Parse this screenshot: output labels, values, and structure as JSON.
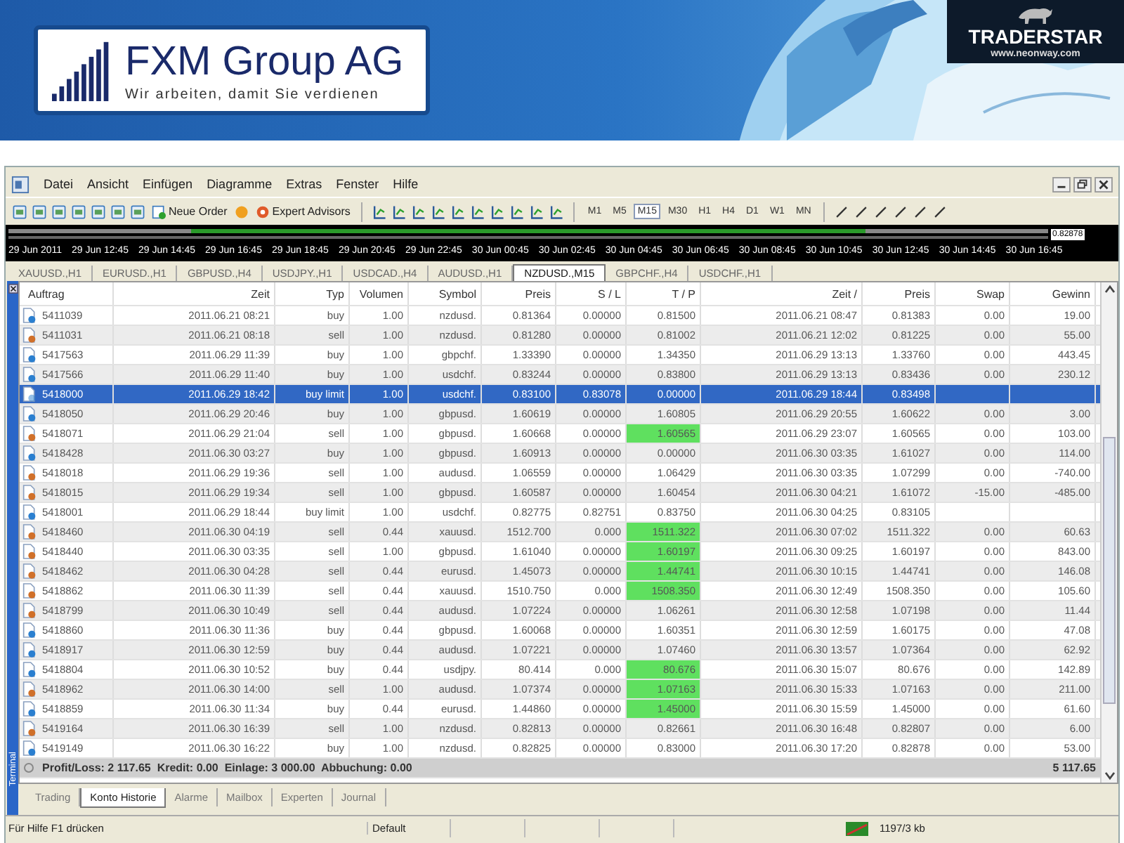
{
  "banner": {
    "company": "FXM Group AG",
    "slogan": "Wir arbeiten, damit Sie verdienen",
    "partner_name": "TRADERSTAR",
    "partner_url": "www.neonway.com"
  },
  "menu": [
    "Datei",
    "Ansicht",
    "Einfügen",
    "Diagramme",
    "Extras",
    "Fenster",
    "Hilfe"
  ],
  "toolbar": {
    "order_button": "Neue Order",
    "experts_button": "Expert Advisors",
    "timeframes": [
      {
        "label": "M1",
        "selected": false
      },
      {
        "label": "M5",
        "selected": false
      },
      {
        "label": "M15",
        "selected": true
      },
      {
        "label": "M30",
        "selected": false
      },
      {
        "label": "H1",
        "selected": false
      },
      {
        "label": "H4",
        "selected": false
      },
      {
        "label": "D1",
        "selected": false
      },
      {
        "label": "W1",
        "selected": false
      },
      {
        "label": "MN",
        "selected": false
      }
    ]
  },
  "chart": {
    "price_label": "0.82878",
    "time_labels": [
      "29 Jun 2011",
      "29 Jun 12:45",
      "29 Jun 14:45",
      "29 Jun 16:45",
      "29 Jun 18:45",
      "29 Jun 20:45",
      "29 Jun 22:45",
      "30 Jun 00:45",
      "30 Jun 02:45",
      "30 Jun 04:45",
      "30 Jun 06:45",
      "30 Jun 08:45",
      "30 Jun 10:45",
      "30 Jun 12:45",
      "30 Jun 14:45",
      "30 Jun 16:45"
    ]
  },
  "chart_tabs": [
    {
      "label": "XAUUSD.,H1",
      "selected": false
    },
    {
      "label": "EURUSD.,H1",
      "selected": false
    },
    {
      "label": "GBPUSD.,H4",
      "selected": false
    },
    {
      "label": "USDJPY.,H1",
      "selected": false
    },
    {
      "label": "USDCAD.,H4",
      "selected": false
    },
    {
      "label": "AUDUSD.,H1",
      "selected": false
    },
    {
      "label": "NZDUSD.,M15",
      "selected": true
    },
    {
      "label": "GBPCHF.,H4",
      "selected": false
    },
    {
      "label": "USDCHF.,H1",
      "selected": false
    }
  ],
  "terminal_label": "Terminal",
  "table": {
    "columns": [
      "Auftrag",
      "Zeit",
      "Typ",
      "Volumen",
      "Symbol",
      "Preis",
      "S / L",
      "T / P",
      "Zeit  /",
      "Preis",
      "Swap",
      "Gewinn"
    ],
    "rows": [
      {
        "kind": "buy",
        "selected": false,
        "tp_hit": false,
        "cells": [
          "5411039",
          "2011.06.21 08:21",
          "buy",
          "1.00",
          "nzdusd.",
          "0.81364",
          "0.00000",
          "0.81500",
          "2011.06.21 08:47",
          "0.81383",
          "0.00",
          "19.00"
        ]
      },
      {
        "kind": "sell",
        "selected": false,
        "tp_hit": false,
        "cells": [
          "5411031",
          "2011.06.21 08:18",
          "sell",
          "1.00",
          "nzdusd.",
          "0.81280",
          "0.00000",
          "0.81002",
          "2011.06.21 12:02",
          "0.81225",
          "0.00",
          "55.00"
        ]
      },
      {
        "kind": "buy",
        "selected": false,
        "tp_hit": false,
        "cells": [
          "5417563",
          "2011.06.29 11:39",
          "buy",
          "1.00",
          "gbpchf.",
          "1.33390",
          "0.00000",
          "1.34350",
          "2011.06.29 13:13",
          "1.33760",
          "0.00",
          "443.45"
        ]
      },
      {
        "kind": "buy",
        "selected": false,
        "tp_hit": false,
        "cells": [
          "5417566",
          "2011.06.29 11:40",
          "buy",
          "1.00",
          "usdchf.",
          "0.83244",
          "0.00000",
          "0.83800",
          "2011.06.29 13:13",
          "0.83436",
          "0.00",
          "230.12"
        ]
      },
      {
        "kind": "buy",
        "selected": true,
        "tp_hit": false,
        "cells": [
          "5418000",
          "2011.06.29 18:42",
          "buy limit",
          "1.00",
          "usdchf.",
          "0.83100",
          "0.83078",
          "0.00000",
          "2011.06.29 18:44",
          "0.83498",
          "",
          ""
        ]
      },
      {
        "kind": "buy",
        "selected": false,
        "tp_hit": false,
        "cells": [
          "5418050",
          "2011.06.29 20:46",
          "buy",
          "1.00",
          "gbpusd.",
          "1.60619",
          "0.00000",
          "1.60805",
          "2011.06.29 20:55",
          "1.60622",
          "0.00",
          "3.00"
        ]
      },
      {
        "kind": "sell",
        "selected": false,
        "tp_hit": true,
        "cells": [
          "5418071",
          "2011.06.29 21:04",
          "sell",
          "1.00",
          "gbpusd.",
          "1.60668",
          "0.00000",
          "1.60565",
          "2011.06.29 23:07",
          "1.60565",
          "0.00",
          "103.00"
        ]
      },
      {
        "kind": "buy",
        "selected": false,
        "tp_hit": false,
        "cells": [
          "5418428",
          "2011.06.30 03:27",
          "buy",
          "1.00",
          "gbpusd.",
          "1.60913",
          "0.00000",
          "0.00000",
          "2011.06.30 03:35",
          "1.61027",
          "0.00",
          "114.00"
        ]
      },
      {
        "kind": "sell",
        "selected": false,
        "tp_hit": false,
        "cells": [
          "5418018",
          "2011.06.29 19:36",
          "sell",
          "1.00",
          "audusd.",
          "1.06559",
          "0.00000",
          "1.06429",
          "2011.06.30 03:35",
          "1.07299",
          "0.00",
          "-740.00"
        ]
      },
      {
        "kind": "sell",
        "selected": false,
        "tp_hit": false,
        "cells": [
          "5418015",
          "2011.06.29 19:34",
          "sell",
          "1.00",
          "gbpusd.",
          "1.60587",
          "0.00000",
          "1.60454",
          "2011.06.30 04:21",
          "1.61072",
          "-15.00",
          "-485.00"
        ]
      },
      {
        "kind": "buy",
        "selected": false,
        "tp_hit": false,
        "cells": [
          "5418001",
          "2011.06.29 18:44",
          "buy limit",
          "1.00",
          "usdchf.",
          "0.82775",
          "0.82751",
          "0.83750",
          "2011.06.30 04:25",
          "0.83105",
          "",
          ""
        ]
      },
      {
        "kind": "sell",
        "selected": false,
        "tp_hit": true,
        "cells": [
          "5418460",
          "2011.06.30 04:19",
          "sell",
          "0.44",
          "xauusd.",
          "1512.700",
          "0.000",
          "1511.322",
          "2011.06.30 07:02",
          "1511.322",
          "0.00",
          "60.63"
        ]
      },
      {
        "kind": "sell",
        "selected": false,
        "tp_hit": true,
        "cells": [
          "5418440",
          "2011.06.30 03:35",
          "sell",
          "1.00",
          "gbpusd.",
          "1.61040",
          "0.00000",
          "1.60197",
          "2011.06.30 09:25",
          "1.60197",
          "0.00",
          "843.00"
        ]
      },
      {
        "kind": "sell",
        "selected": false,
        "tp_hit": true,
        "cells": [
          "5418462",
          "2011.06.30 04:28",
          "sell",
          "0.44",
          "eurusd.",
          "1.45073",
          "0.00000",
          "1.44741",
          "2011.06.30 10:15",
          "1.44741",
          "0.00",
          "146.08"
        ]
      },
      {
        "kind": "sell",
        "selected": false,
        "tp_hit": true,
        "cells": [
          "5418862",
          "2011.06.30 11:39",
          "sell",
          "0.44",
          "xauusd.",
          "1510.750",
          "0.000",
          "1508.350",
          "2011.06.30 12:49",
          "1508.350",
          "0.00",
          "105.60"
        ]
      },
      {
        "kind": "sell",
        "selected": false,
        "tp_hit": false,
        "cells": [
          "5418799",
          "2011.06.30 10:49",
          "sell",
          "0.44",
          "audusd.",
          "1.07224",
          "0.00000",
          "1.06261",
          "2011.06.30 12:58",
          "1.07198",
          "0.00",
          "11.44"
        ]
      },
      {
        "kind": "buy",
        "selected": false,
        "tp_hit": false,
        "cells": [
          "5418860",
          "2011.06.30 11:36",
          "buy",
          "0.44",
          "gbpusd.",
          "1.60068",
          "0.00000",
          "1.60351",
          "2011.06.30 12:59",
          "1.60175",
          "0.00",
          "47.08"
        ]
      },
      {
        "kind": "buy",
        "selected": false,
        "tp_hit": false,
        "cells": [
          "5418917",
          "2011.06.30 12:59",
          "buy",
          "0.44",
          "audusd.",
          "1.07221",
          "0.00000",
          "1.07460",
          "2011.06.30 13:57",
          "1.07364",
          "0.00",
          "62.92"
        ]
      },
      {
        "kind": "buy",
        "selected": false,
        "tp_hit": true,
        "cells": [
          "5418804",
          "2011.06.30 10:52",
          "buy",
          "0.44",
          "usdjpy.",
          "80.414",
          "0.000",
          "80.676",
          "2011.06.30 15:07",
          "80.676",
          "0.00",
          "142.89"
        ]
      },
      {
        "kind": "sell",
        "selected": false,
        "tp_hit": true,
        "cells": [
          "5418962",
          "2011.06.30 14:00",
          "sell",
          "1.00",
          "audusd.",
          "1.07374",
          "0.00000",
          "1.07163",
          "2011.06.30 15:33",
          "1.07163",
          "0.00",
          "211.00"
        ]
      },
      {
        "kind": "buy",
        "selected": false,
        "tp_hit": true,
        "cells": [
          "5418859",
          "2011.06.30 11:34",
          "buy",
          "0.44",
          "eurusd.",
          "1.44860",
          "0.00000",
          "1.45000",
          "2011.06.30 15:59",
          "1.45000",
          "0.00",
          "61.60"
        ]
      },
      {
        "kind": "sell",
        "selected": false,
        "tp_hit": false,
        "cells": [
          "5419164",
          "2011.06.30 16:39",
          "sell",
          "1.00",
          "nzdusd.",
          "0.82813",
          "0.00000",
          "0.82661",
          "2011.06.30 16:48",
          "0.82807",
          "0.00",
          "6.00"
        ]
      },
      {
        "kind": "buy",
        "selected": false,
        "tp_hit": false,
        "cells": [
          "5419149",
          "2011.06.30 16:22",
          "buy",
          "1.00",
          "nzdusd.",
          "0.82825",
          "0.00000",
          "0.83000",
          "2011.06.30 17:20",
          "0.82878",
          "0.00",
          "53.00"
        ]
      }
    ]
  },
  "summary": {
    "text": "Profit/Loss: 2 117.65  Kredit: 0.00  Einlage: 3 000.00  Abbuchung: 0.00",
    "total": "5 117.65"
  },
  "bottom_tabs": [
    {
      "label": "Trading",
      "selected": false
    },
    {
      "label": "Konto Historie",
      "selected": true
    },
    {
      "label": "Alarme",
      "selected": false
    },
    {
      "label": "Mailbox",
      "selected": false
    },
    {
      "label": "Experten",
      "selected": false
    },
    {
      "label": "Journal",
      "selected": false
    }
  ],
  "status": {
    "help": "Für Hilfe F1 drücken",
    "profile": "Default",
    "traffic": "1197/3 kb"
  }
}
